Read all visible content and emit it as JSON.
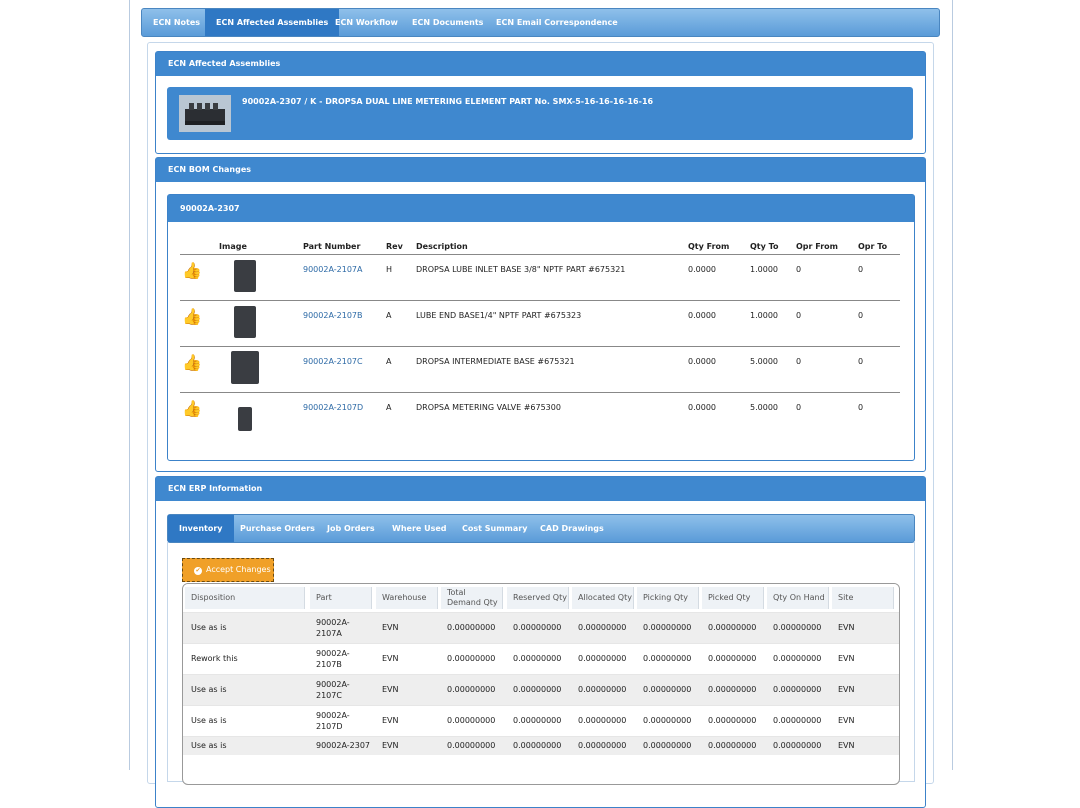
{
  "top_tabs": [
    "ECN Notes",
    "ECN Affected Assemblies",
    "ECN Workflow",
    "ECN Documents",
    "ECN Email Correspondence"
  ],
  "affected": {
    "title": "ECN Affected Assemblies",
    "assembly_text": "90002A-2307   /  K   -   DROPSA DUAL LINE METERING ELEMENT PART No. SMX-5-16-16-16-16-16"
  },
  "bom": {
    "title": "ECN BOM Changes",
    "assembly": "90002A-2307",
    "headers": [
      "Image",
      "Part Number",
      "Rev",
      "Description",
      "Qty From",
      "Qty To",
      "Opr From",
      "Opr To"
    ],
    "rows": [
      {
        "part": "90002A-2107A",
        "rev": "H",
        "desc": "DROPSA LUBE INLET BASE 3/8\" NPTF PART #675321",
        "qty_from": "0.0000",
        "qty_to": "1.0000",
        "opr_from": "0",
        "opr_to": "0"
      },
      {
        "part": "90002A-2107B",
        "rev": "A",
        "desc": "LUBE END BASE1/4\" NPTF PART #675323",
        "qty_from": "0.0000",
        "qty_to": "1.0000",
        "opr_from": "0",
        "opr_to": "0"
      },
      {
        "part": "90002A-2107C",
        "rev": "A",
        "desc": "DROPSA INTERMEDIATE BASE #675321",
        "qty_from": "0.0000",
        "qty_to": "5.0000",
        "opr_from": "0",
        "opr_to": "0"
      },
      {
        "part": "90002A-2107D",
        "rev": "A",
        "desc": "DROPSA METERING VALVE #675300",
        "qty_from": "0.0000",
        "qty_to": "5.0000",
        "opr_from": "0",
        "opr_to": "0"
      }
    ]
  },
  "erp": {
    "title": "ECN ERP Information",
    "tabs": [
      "Inventory",
      "Purchase Orders",
      "Job Orders",
      "Where Used",
      "Cost Summary",
      "CAD Drawings"
    ],
    "accept_label": "Accept Changes",
    "headers": [
      "Disposition",
      "Part",
      "Warehouse",
      "Total Demand Qty",
      "Reserved Qty",
      "Allocated Qty",
      "Picking Qty",
      "Picked Qty",
      "Qty On Hand",
      "Site"
    ],
    "rows": [
      {
        "disposition": "Use as is",
        "part": "90002A-2107A",
        "warehouse": "EVN",
        "total": "0.00000000",
        "reserved": "0.00000000",
        "allocated": "0.00000000",
        "picking": "0.00000000",
        "picked": "0.00000000",
        "onhand": "0.00000000",
        "site": "EVN"
      },
      {
        "disposition": "Rework this",
        "part": "90002A-2107B",
        "warehouse": "EVN",
        "total": "0.00000000",
        "reserved": "0.00000000",
        "allocated": "0.00000000",
        "picking": "0.00000000",
        "picked": "0.00000000",
        "onhand": "0.00000000",
        "site": "EVN"
      },
      {
        "disposition": "Use as is",
        "part": "90002A-2107C",
        "warehouse": "EVN",
        "total": "0.00000000",
        "reserved": "0.00000000",
        "allocated": "0.00000000",
        "picking": "0.00000000",
        "picked": "0.00000000",
        "onhand": "0.00000000",
        "site": "EVN"
      },
      {
        "disposition": "Use as is",
        "part": "90002A-2107D",
        "warehouse": "EVN",
        "total": "0.00000000",
        "reserved": "0.00000000",
        "allocated": "0.00000000",
        "picking": "0.00000000",
        "picked": "0.00000000",
        "onhand": "0.00000000",
        "site": "EVN"
      },
      {
        "disposition": "Use as is",
        "part": "90002A-2307",
        "warehouse": "EVN",
        "total": "0.00000000",
        "reserved": "0.00000000",
        "allocated": "0.00000000",
        "picking": "0.00000000",
        "picked": "0.00000000",
        "onhand": "0.00000000",
        "site": "EVN"
      }
    ]
  },
  "colors": {
    "accent": "#3f88cf",
    "button": "#f0a028",
    "link": "#2d6aa6",
    "approve": "#3bb33b"
  }
}
